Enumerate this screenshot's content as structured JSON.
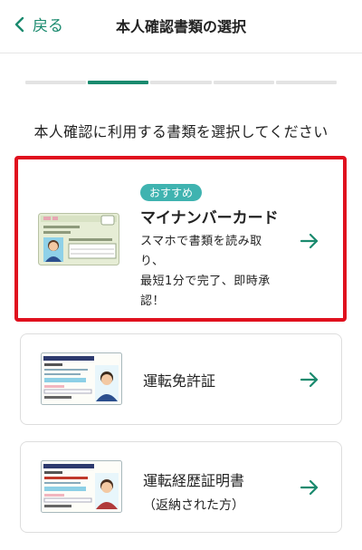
{
  "header": {
    "back_label": "戻る",
    "title": "本人確認書類の選択"
  },
  "progress": {
    "total_steps": 5,
    "current_step": 2
  },
  "subtitle": "本人確認に利用する書類を選択してください",
  "options": [
    {
      "badge": "おすすめ",
      "title": "マイナンバーカード",
      "description_lines": [
        "スマホで書類を読み取",
        "り、",
        "最短1分で完了、即時承",
        "認！"
      ]
    },
    {
      "title": "運転免許証"
    },
    {
      "title": "運転経歴証明書",
      "subtitle": "（返納された方）"
    }
  ],
  "colors": {
    "accent": "#1a8a6e",
    "highlight_border": "#e0101e",
    "badge_bg": "#3fb3b0"
  },
  "icons": {
    "back": "chevron-left-icon",
    "arrow": "arrow-right-icon"
  }
}
